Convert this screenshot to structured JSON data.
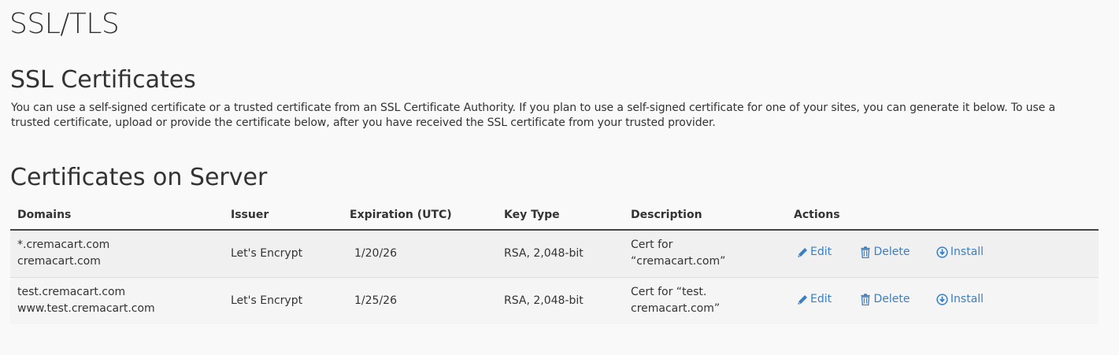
{
  "page": {
    "title": "SSL/TLS"
  },
  "ssl_section": {
    "heading": "SSL Certificates",
    "description": "You can use a self-signed certificate or a trusted certificate from an SSL Certificate Authority. If you plan to use a self-signed certificate for one of your sites, you can generate it below. To use a trusted certificate, upload or provide the certificate below, after you have received the SSL certificate from your trusted provider."
  },
  "server_section": {
    "heading": "Certificates on Server",
    "columns": {
      "domains": "Domains",
      "issuer": "Issuer",
      "expiration": "Expiration (UTC)",
      "key_type": "Key Type",
      "description": "Description",
      "actions": "Actions"
    },
    "rows": [
      {
        "domain_1": "*.cremacart.com",
        "domain_2": "cremacart.com",
        "issuer": "Let's Encrypt",
        "expiration": "1/20/26",
        "key_type": "RSA, 2,048-bit",
        "description_1": "Cert for",
        "description_2": "“cremacart.com”",
        "edit_label": "Edit",
        "delete_label": "Delete",
        "install_label": "Install"
      },
      {
        "domain_1": "test.cremacart.com",
        "domain_2": "www.test.cremacart.com",
        "issuer": "Let's Encrypt",
        "expiration": "1/25/26",
        "key_type": "RSA, 2,048-bit",
        "description_1": "Cert for “test.",
        "description_2": "cremacart.com”",
        "edit_label": "Edit",
        "delete_label": "Delete",
        "install_label": "Install"
      }
    ]
  },
  "colors": {
    "link": "#3a7fc1",
    "text": "#333333",
    "background": "#f9f9f9"
  },
  "icons": {
    "edit": "pencil-icon",
    "delete": "trash-icon",
    "install": "download-circle-icon"
  }
}
